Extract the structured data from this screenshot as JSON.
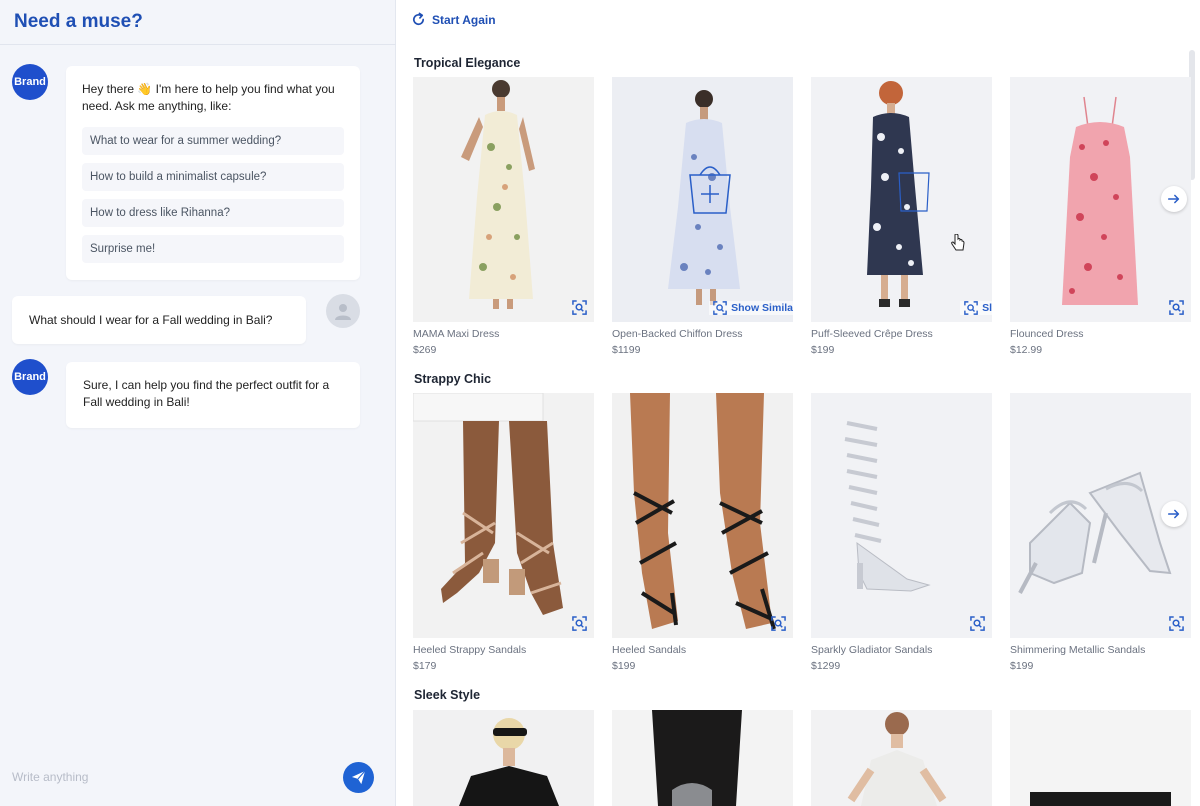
{
  "chat": {
    "title": "Need a muse?",
    "brand_label": "Brand",
    "greeting_line1": "Hey there 👋 I'm here to help you find what you",
    "greeting_line2": "need. Ask me anything, like:",
    "suggestions": [
      "What to wear for a summer wedding?",
      "How to build a minimalist capsule?",
      "How to dress like Rihanna?",
      "Surprise me!"
    ],
    "user_message": "What should I wear for a Fall wedding in Bali?",
    "reply_line1": "Sure, I can help you find the perfect outfit for a",
    "reply_line2": "Fall wedding in Bali!",
    "input_placeholder": "Write anything",
    "send_icon": "paper-plane-icon"
  },
  "toolbar": {
    "start_again_label": "Start Again",
    "start_again_icon": "refresh-icon"
  },
  "sections": [
    {
      "title": "Tropical Elegance",
      "products": [
        {
          "name": "MAMA Maxi Dress",
          "price": "$269"
        },
        {
          "name": "Open-Backed Chiffon Dress",
          "price": "$1199"
        },
        {
          "name": "Puff-Sleeved Crêpe Dress",
          "price": "$199"
        },
        {
          "name": "Flounced Dress",
          "price": "$12.99"
        }
      ]
    },
    {
      "title": "Strappy Chic",
      "products": [
        {
          "name": "Heeled Strappy Sandals",
          "price": "$179"
        },
        {
          "name": "Heeled Sandals",
          "price": "$199"
        },
        {
          "name": "Sparkly Gladiator Sandals",
          "price": "$1299"
        },
        {
          "name": "Shimmering Metallic Sandals",
          "price": "$199"
        }
      ]
    },
    {
      "title": "Sleek Style",
      "products": []
    }
  ],
  "overlays": {
    "show_similar_label": "Show Simila",
    "show_similar_short": "Sl"
  },
  "colors": {
    "accent": "#1f4fb4",
    "send_button": "#1f63d4",
    "brand_avatar": "#1f4fcc"
  }
}
